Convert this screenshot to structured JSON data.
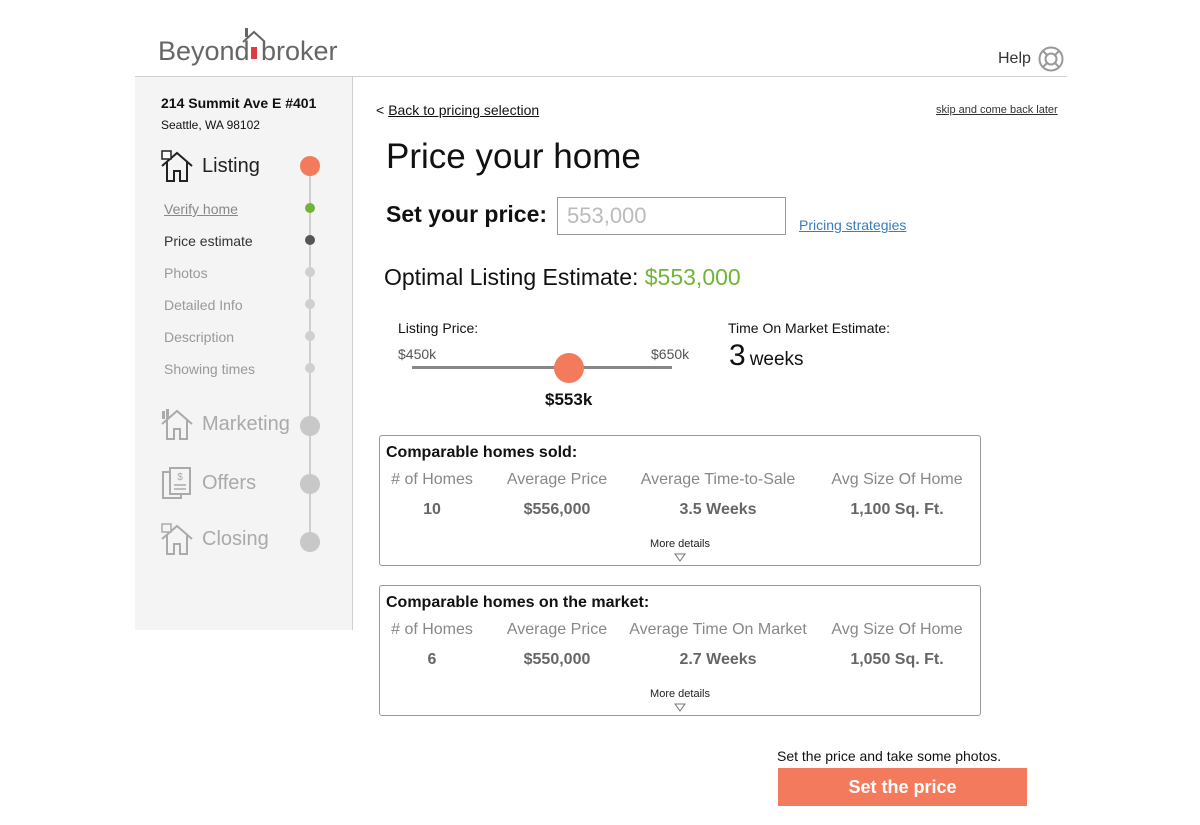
{
  "header": {
    "logo_left": "Beyond",
    "logo_right": "broker",
    "help_label": "Help",
    "colors": {
      "accent": "#f47a5e",
      "logo_red": "#e03a3e",
      "success": "#6fb537",
      "link": "#3b7bbf"
    }
  },
  "sidebar": {
    "address_line1": "214 Summit Ave E #401",
    "address_line2": "Seattle, WA 98102",
    "sections": [
      {
        "label": "Listing",
        "icon": "house-icon",
        "state": "active"
      },
      {
        "label": "Marketing",
        "icon": "marketing-house-icon",
        "state": "inactive"
      },
      {
        "label": "Offers",
        "icon": "documents-dollar-icon",
        "state": "inactive"
      },
      {
        "label": "Closing",
        "icon": "closing-house-icon",
        "state": "inactive"
      }
    ],
    "steps": [
      {
        "label": "Verify home",
        "state": "complete"
      },
      {
        "label": "Price estimate",
        "state": "current"
      },
      {
        "label": "Photos",
        "state": "pending"
      },
      {
        "label": "Detailed Info",
        "state": "pending"
      },
      {
        "label": "Description",
        "state": "pending"
      },
      {
        "label": "Showing times",
        "state": "pending"
      }
    ]
  },
  "main": {
    "back_link": "Back to pricing selection",
    "back_prefix": "<",
    "skip_link": "skip and come back later",
    "title": "Price your home",
    "set_price_label": "Set your price:",
    "price_placeholder": "553,000",
    "pricing_strategies_link": "Pricing strategies",
    "optimal_label": "Optimal Listing Estimate:",
    "optimal_value": "$553,000",
    "listing_price_label": "Listing Price:",
    "slider_min": "$450k",
    "slider_max": "$650k",
    "slider_value": "$553k",
    "slider_fraction": 0.515,
    "time_on_market_label": "Time On Market Estimate:",
    "time_on_market_value": "3",
    "time_on_market_unit": "weeks",
    "comparables": [
      {
        "title": "Comparable homes sold:",
        "columns": [
          "# of Homes",
          "Average Price",
          "Average Time-to-Sale",
          "Avg Size Of Home"
        ],
        "values": [
          "10",
          "$556,000",
          "3.5 Weeks",
          "1,100 Sq. Ft."
        ],
        "more_label": "More details"
      },
      {
        "title": "Comparable homes on the market:",
        "columns": [
          "# of Homes",
          "Average Price",
          "Average Time On Market",
          "Avg Size Of Home"
        ],
        "values": [
          "6",
          "$550,000",
          "2.7 Weeks",
          "1,050 Sq. Ft."
        ],
        "more_label": "More details"
      }
    ],
    "footer_note": "Set the price and take some photos.",
    "cta_label": "Set the price"
  }
}
